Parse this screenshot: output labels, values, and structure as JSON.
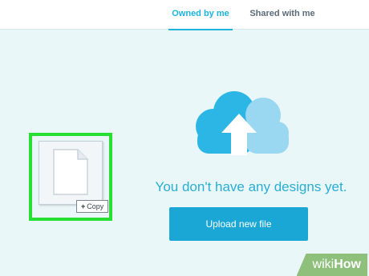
{
  "tabs": {
    "owned": "Owned by me",
    "shared": "Shared with me"
  },
  "drag": {
    "copy_label": "Copy"
  },
  "empty_state": {
    "message": "You don't have any designs yet.",
    "upload_label": "Upload new file"
  },
  "watermark": {
    "part1": "wiki",
    "part2": "How"
  },
  "icons": {
    "cloud": "cloud-upload-icon",
    "document": "document-icon",
    "plus": "plus-icon"
  },
  "colors": {
    "accent": "#1eb3dc",
    "button": "#1aa7d6",
    "highlight": "#25e032",
    "cloud_dark": "#2bb6e6",
    "cloud_light": "#9ad8f1"
  }
}
